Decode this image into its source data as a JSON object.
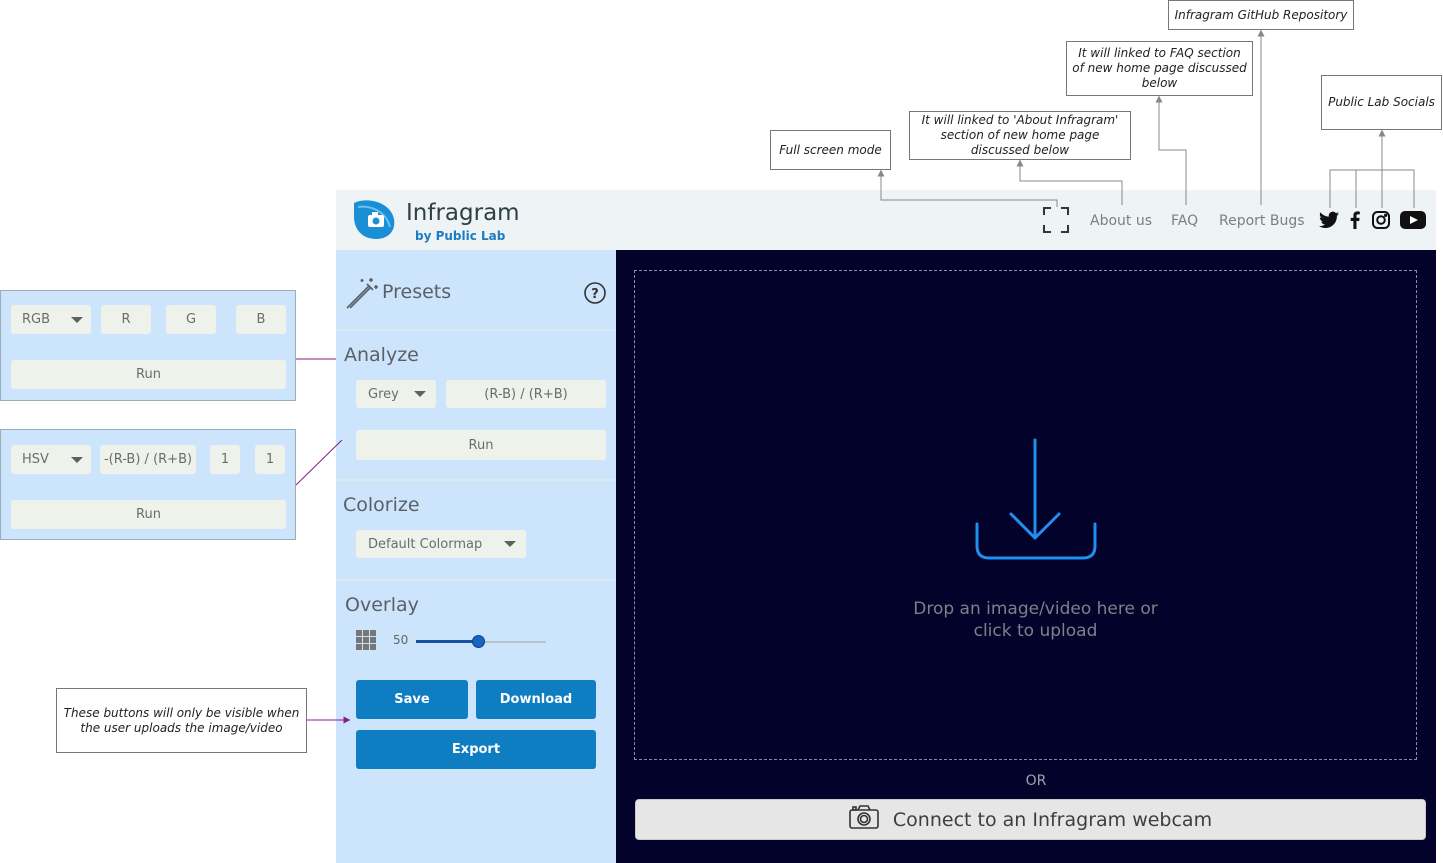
{
  "annotations": {
    "fullscreen": "Full screen mode",
    "about": "It will linked to 'About Infragram' section of  new home page discussed below",
    "faq": "It will linked to FAQ section of  new home page discussed below",
    "github": "Infragram GitHub Repository",
    "socials": "Public Lab Socials",
    "buttons": "These buttons will only be visible when the user uploads the image/video"
  },
  "header": {
    "title": "Infragram",
    "subtitle": "by Public Lab",
    "nav": [
      "About us",
      "FAQ",
      "Report Bugs"
    ],
    "icons": [
      "fullscreen-icon",
      "twitter-icon",
      "facebook-icon",
      "instagram-icon",
      "youtube-icon"
    ]
  },
  "sidebar": {
    "presets_label": "Presets",
    "analyze": {
      "title": "Analyze",
      "mode": "Grey",
      "expression": "(R-B) / (R+B)",
      "run": "Run"
    },
    "colorize": {
      "title": "Colorize",
      "colormap": "Default Colormap"
    },
    "overlay": {
      "title": "Overlay",
      "value": "50",
      "slider_fraction": 0.48
    },
    "buttons": {
      "save": "Save",
      "download": "Download",
      "export": "Export"
    }
  },
  "rgb_panel": {
    "mode": "RGB",
    "channels": [
      "R",
      "G",
      "B"
    ],
    "run": "Run"
  },
  "hsv_panel": {
    "mode": "HSV",
    "expression": "-(R-B) / (R+B)",
    "values": [
      "1",
      "1"
    ],
    "run": "Run"
  },
  "main": {
    "drop_text_line1": "Drop an image/video here or",
    "drop_text_line2": "click to upload",
    "or": "OR",
    "webcam": "Connect to an Infragram webcam"
  },
  "colors": {
    "accent": "#0e7dc2",
    "sidebar": "#cce5fc",
    "main_bg": "#02022a",
    "annotation_line": "#8b1a8b"
  }
}
